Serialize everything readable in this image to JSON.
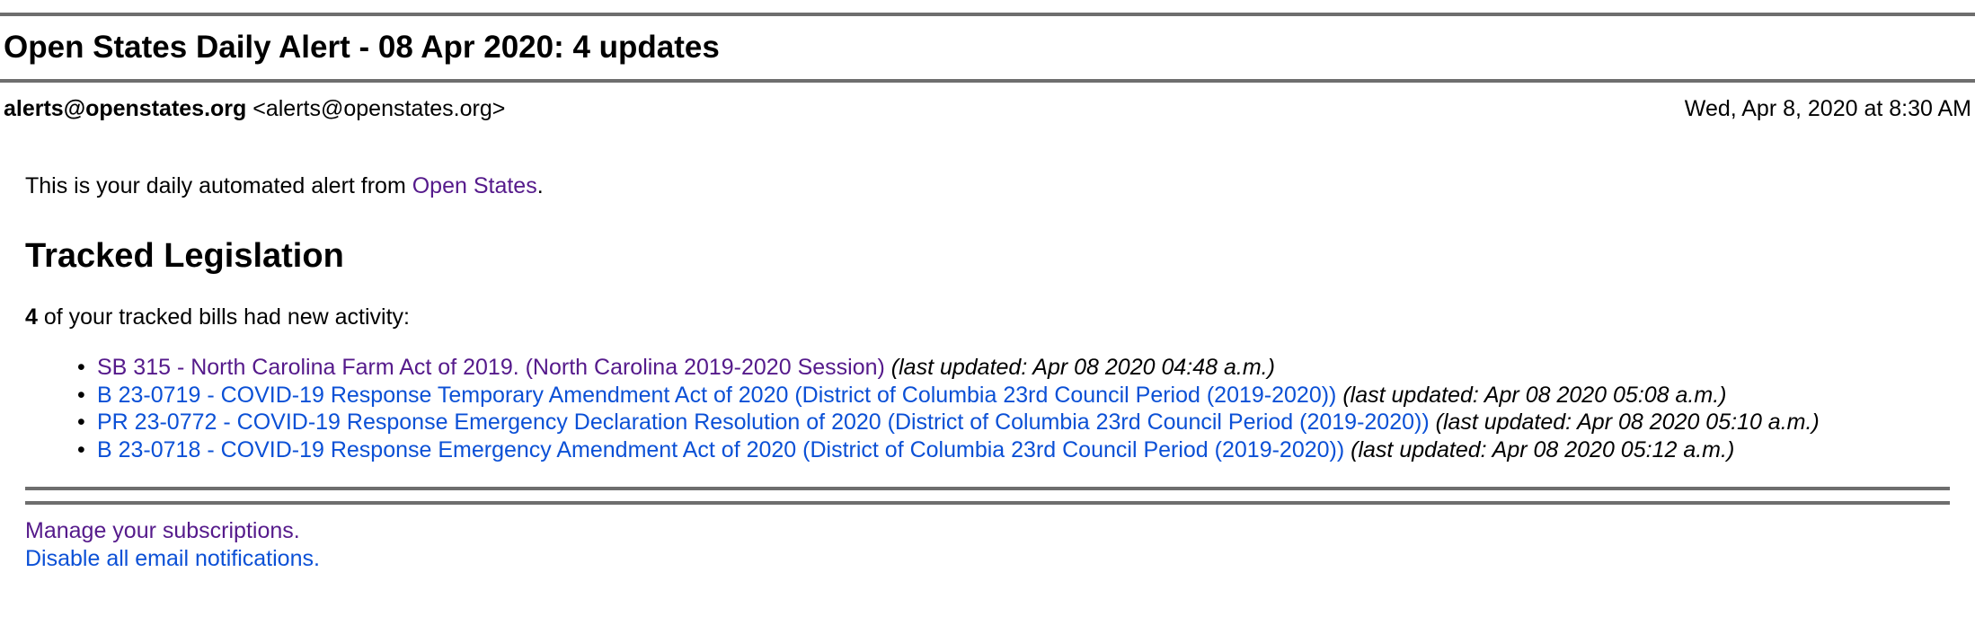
{
  "email": {
    "subject": "Open States Daily Alert - 08 Apr 2020: 4 updates",
    "from_name": "alerts@openstates.org",
    "from_address": "<alerts@openstates.org>",
    "date": "Wed, Apr 8, 2020 at 8:30 AM"
  },
  "content": {
    "intro_prefix": "This is your daily automated alert from ",
    "intro_link": "Open States",
    "intro_suffix": ".",
    "heading": "Tracked Legislation",
    "count": "4",
    "count_suffix": " of your tracked bills had new activity:",
    "bills": [
      {
        "title": "SB 315 - North Carolina Farm Act of 2019. (North Carolina 2019-2020 Session)",
        "updated": "(last updated: Apr 08 2020 04:48 a.m.)"
      },
      {
        "title": "B 23-0719 - COVID-19 Response Temporary Amendment Act of 2020 (District of Columbia 23rd Council Period (2019-2020))",
        "updated": "(last updated: Apr 08 2020 05:08 a.m.)"
      },
      {
        "title": "PR 23-0772 - COVID-19 Response Emergency Declaration Resolution of 2020 (District of Columbia 23rd Council Period (2019-2020))",
        "updated": "(last updated: Apr 08 2020 05:10 a.m.)"
      },
      {
        "title": "B 23-0718 - COVID-19 Response Emergency Amendment Act of 2020 (District of Columbia 23rd Council Period (2019-2020))",
        "updated": "(last updated: Apr 08 2020 05:12 a.m.)"
      }
    ]
  },
  "footer": {
    "manage_link": "Manage your subscriptions.",
    "disable_link": "Disable all email notifications."
  },
  "colors": {
    "visited_link": "#551a8b",
    "unvisited_link": "#0b50d6",
    "rule": "#6e6e6e"
  }
}
